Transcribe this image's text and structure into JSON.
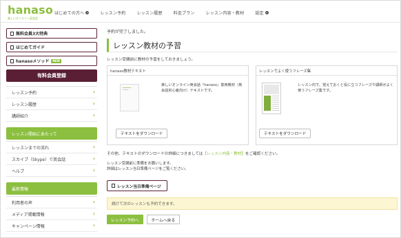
{
  "logo": {
    "name": "hanaso",
    "tagline": "楽しいオンライン英会話"
  },
  "nav": [
    {
      "label": "はじめての方へ",
      "dropdown": true
    },
    {
      "label": "レッスン予約",
      "dropdown": false
    },
    {
      "label": "レッスン履歴",
      "dropdown": false
    },
    {
      "label": "料金プラン",
      "dropdown": false
    },
    {
      "label": "レッスン内容・教材",
      "dropdown": false
    },
    {
      "label": "設定",
      "dropdown": true
    }
  ],
  "sidebar": {
    "buttons": [
      {
        "label": "無料会員3大特典"
      },
      {
        "label": "はじめてガイド"
      },
      {
        "label": "hanasoメソッド",
        "badge": "NEW"
      }
    ],
    "primary": "有料会員登録",
    "list1": [
      "レッスン予約",
      "レッスン履歴",
      "講師紹介"
    ],
    "section1": "レッスン開始にあたって",
    "list2": [
      "レッスンまでの流れ",
      "スカイプ（Skype）で英会話",
      "ヘルプ"
    ],
    "section2": "最新情報",
    "list3": [
      "利用者の声",
      "メディア掲載情報",
      "キャンペーン情報"
    ]
  },
  "main": {
    "done": "予約が完了しました。",
    "title": "レッスン教材の予習",
    "desc": "レッスン受講前に教材の予習をしておきましょう。",
    "card1": {
      "head": "hanaso教材テキスト",
      "text": "楽しいオンライン英会話『hanaso』専用教材（英会話初心者向け）テキストです。",
      "button": "テキストをダウンロード"
    },
    "card2": {
      "head": "レッスンでよく使うフレーズ集",
      "text": "レッスン内で、覚えておくと役に立つフレーズや講師がよく使うフレーズ集です。",
      "button": "テキストをダウンロード"
    },
    "info_prefix": "その他、テキストのダウンロードの詳細につきましては",
    "info_link": "【レッスン内容・教材】",
    "info_suffix": "をご確認ください。",
    "prep_line1": "レッスン受講前に準備をお願いします。",
    "prep_line2": "詳細はレッスン当日準備ページをご覧ください。",
    "prep_button": "レッスン当日準備ページ",
    "notice": "続けて次のレッスンも予約できます。",
    "btn_reserve": "レッスン予約へ",
    "btn_home": "ホームへ戻る"
  },
  "colors": {
    "brand_green": "#8cbf3f",
    "brand_maroon": "#5a1f35",
    "notice_bg": "#fdf6d3"
  }
}
